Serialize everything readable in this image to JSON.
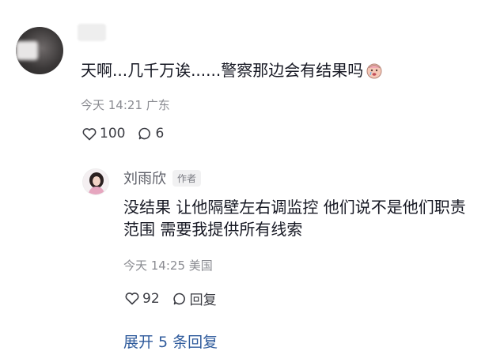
{
  "comment": {
    "text": "天啊...几千万诶......警察那边会有结果吗",
    "emoji_icon": "crying-baby-emoji",
    "time": "今天 14:21",
    "location": "广东",
    "likes": "100",
    "replies": "6"
  },
  "reply": {
    "author": "刘雨欣",
    "author_badge": "作者",
    "text": "没结果 让他隔壁左右调监控 他们说不是他们职责范围 需要我提供所有线索",
    "time": "今天 14:25",
    "location": "美国",
    "likes": "92",
    "reply_label": "回复"
  },
  "more_replies": "展开 5 条回复"
}
